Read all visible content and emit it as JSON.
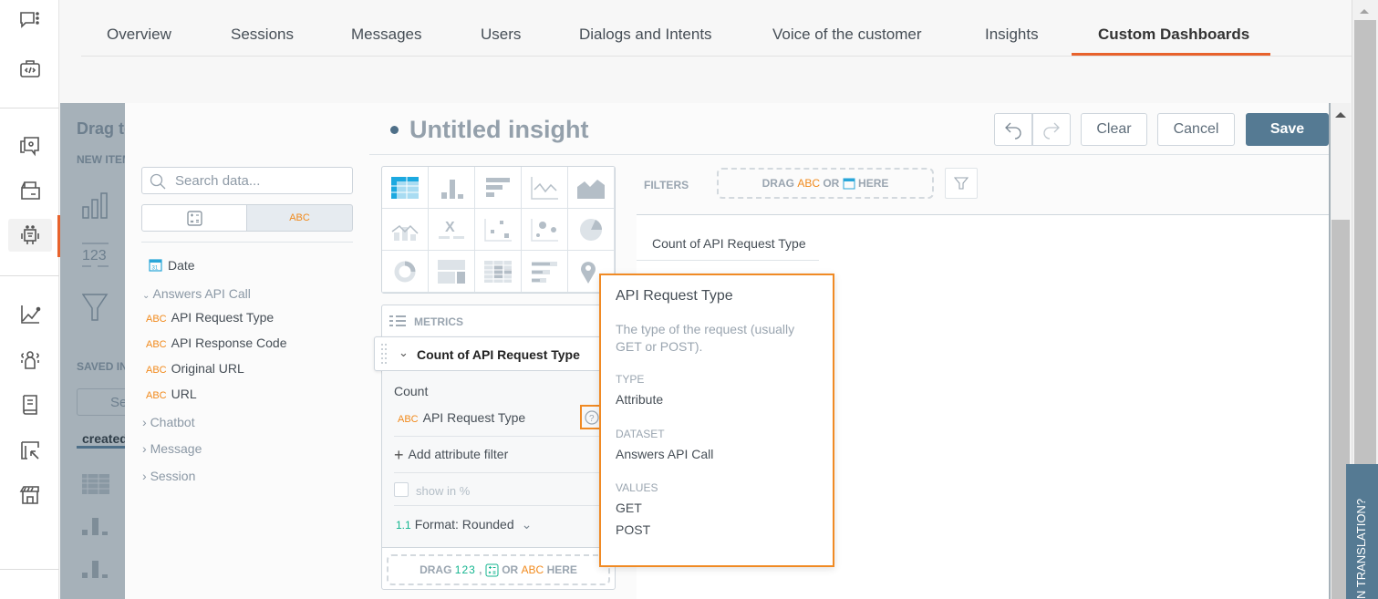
{
  "nav": {
    "tabs": [
      {
        "label": "Overview",
        "active": false
      },
      {
        "label": "Sessions",
        "active": false
      },
      {
        "label": "Messages",
        "active": false
      },
      {
        "label": "Users",
        "active": false
      },
      {
        "label": "Dialogs and Intents",
        "active": false
      },
      {
        "label": "Voice of the customer",
        "active": false
      },
      {
        "label": "Insights",
        "active": false
      },
      {
        "label": "Custom Dashboards",
        "active": true
      }
    ],
    "accent_color": "#e8622c"
  },
  "rail": {
    "icons": [
      "conversation-icon",
      "developer-kit-icon",
      "knowledge-chat-icon",
      "inbox-icon",
      "chatbot-icon",
      "analytics-icon",
      "users-group-icon",
      "guide-book-icon",
      "layout-cursor-icon",
      "store-icon"
    ],
    "active": "chatbot-icon"
  },
  "background_panel": {
    "title": "Drag to",
    "new_items_label": "NEW ITEM",
    "saved_label": "SAVED IN",
    "search_placeholder": "Se",
    "tab_label": "created"
  },
  "catalog": {
    "search_placeholder": "Search data...",
    "filter_tabs": [
      {
        "label": "calculator",
        "active": false
      },
      {
        "label": "ABC",
        "active": true
      }
    ],
    "date_label": "Date",
    "group_expanded": "Answers API Call",
    "attributes": [
      "API Request Type",
      "API Response Code",
      "Original URL",
      "URL"
    ],
    "groups_collapsed": [
      "Chatbot",
      "Message",
      "Session"
    ],
    "abc_tag": "ABC"
  },
  "editor": {
    "title": "Untitled insight",
    "buttons": {
      "clear": "Clear",
      "cancel": "Cancel",
      "save": "Save"
    },
    "save_color": "#557a93"
  },
  "viz_types": [
    "table",
    "column",
    "bar",
    "line",
    "area",
    "combo",
    "headline",
    "scatter",
    "bubble",
    "pie",
    "donut",
    "treemap",
    "heatmap",
    "bullet",
    "geo"
  ],
  "bucket": {
    "section_label": "METRICS",
    "metric_title": "Count of API Request Type",
    "aggregation": "Count",
    "attribute": "API Request Type",
    "add_filter": "Add attribute filter",
    "show_percent": "show in %",
    "format_prefix": "1.1",
    "format_label": "Format: Rounded",
    "drop_text": [
      "DRAG",
      "123",
      ",",
      "OR",
      "ABC",
      "HERE"
    ]
  },
  "filters": {
    "label": "FILTERS",
    "drop_text": [
      "DRAG",
      "ABC",
      "OR",
      "HERE"
    ],
    "column_header": "Count of API Request Type"
  },
  "tooltip": {
    "title": "API Request Type",
    "description_line1": "The type of the request (usually",
    "description_line2": "GET or POST).",
    "type_label": "TYPE",
    "type_value": "Attribute",
    "dataset_label": "DATASET",
    "dataset_value": "Answers API Call",
    "values_label": "VALUES",
    "values": [
      "GET",
      "POST"
    ],
    "border_color": "#f08a24"
  },
  "side_banner": {
    "text": "N TRANSLATION?"
  }
}
